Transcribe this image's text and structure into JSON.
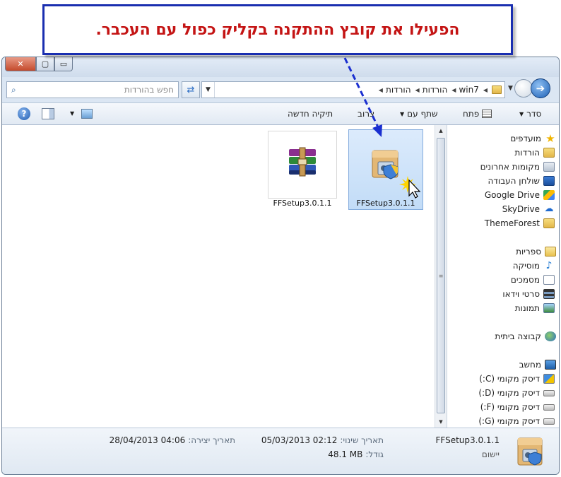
{
  "callout": {
    "text": "הפעילו את קובץ ההתקנה בקליק כפול עם העכבר."
  },
  "window": {
    "controls": {
      "close": "✕",
      "maximize": "▢",
      "minimize": "▭"
    }
  },
  "address": {
    "search_placeholder": "חפש בהורדות",
    "crumbs": [
      "win7",
      "הורדות",
      "הורדות"
    ]
  },
  "toolbar": {
    "organize": "סדר",
    "open": "פתח",
    "share": "שתף עם",
    "burn": "צרוב",
    "new_folder": "תיקיה חדשה"
  },
  "files": [
    {
      "name": "FFSetup3.0.1.1",
      "type": "installer",
      "selected": true
    },
    {
      "name": "FFSetup3.0.1.1",
      "type": "winrar-archive",
      "selected": false
    }
  ],
  "nav": {
    "favorites": {
      "label": "מועדפים",
      "items": [
        "הורדות",
        "מקומות אחרונים",
        "שולחן העבודה",
        "Google Drive",
        "SkyDrive",
        "ThemeForest"
      ]
    },
    "libraries": {
      "label": "ספריות",
      "items": [
        "מוסיקה",
        "מסמכים",
        "סרטי וידאו",
        "תמונות"
      ]
    },
    "homegroup": {
      "label": "קבוצה ביתית"
    },
    "computer": {
      "label": "מחשב",
      "items": [
        "דיסק מקומי (C:)",
        "דיסק מקומי (D:)",
        "דיסק מקומי (F:)",
        "דיסק מקומי (G:)"
      ]
    }
  },
  "details": {
    "name": "FFSetup3.0.1.1",
    "type": "יישום",
    "modified_label": "תאריך שינוי:",
    "modified_value": "05/03/2013 02:12",
    "size_label": "גודל:",
    "size_value": "48.1 MB",
    "created_label": "תאריך יצירה:",
    "created_value": "28/04/2013 04:06"
  }
}
